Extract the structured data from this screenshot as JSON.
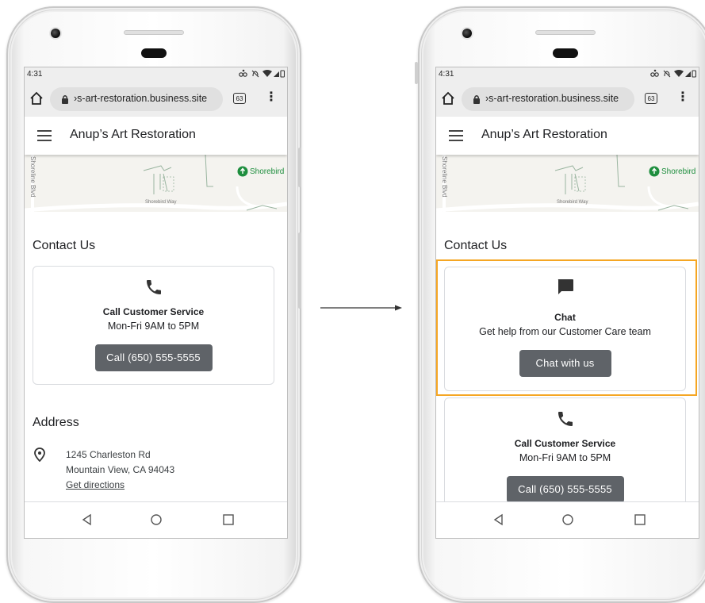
{
  "device": {
    "status": {
      "time": "4:31"
    },
    "browser": {
      "url": "›s-art-restoration.business.site",
      "tab_count": "63",
      "menu_glyph": "⋮"
    }
  },
  "app": {
    "title": "Anup’s Art Restoration"
  },
  "map": {
    "place": "Shorebird",
    "road": "Shorebird Way",
    "blvd": "Shoreline Blvd"
  },
  "contact": {
    "title": "Contact Us",
    "call": {
      "title": "Call Customer Service",
      "hours": "Mon-Fri 9AM to 5PM",
      "button": "Call (650) 555-5555"
    },
    "chat": {
      "title": "Chat",
      "description": "Get help from our Customer Care team",
      "button": "Chat with us"
    }
  },
  "address": {
    "title": "Address",
    "line1": "1245 Charleston Rd",
    "line2": "Mountain View, CA 94043",
    "directions": "Get directions"
  },
  "colors": {
    "button": "#5f6368",
    "highlight": "#f5a623",
    "place_green": "#1e8e3e",
    "chrome_bg": "#eeeeee"
  },
  "icons": [
    "home-icon",
    "lock-icon",
    "tabs-icon",
    "more-vert-icon",
    "hamburger-icon",
    "map-pin-icon",
    "phone-icon",
    "chat-icon",
    "location-pin-icon",
    "back-icon",
    "home-circle-icon",
    "recents-icon",
    "arrow-right-icon"
  ]
}
